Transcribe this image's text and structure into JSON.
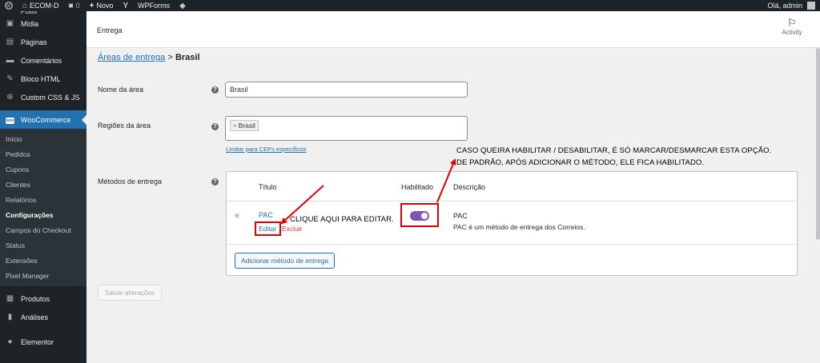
{
  "adminbar": {
    "site_name": "ECOM-D",
    "comments_count": "0",
    "new_label": "Novo",
    "wpforms_label": "WPForms",
    "greeting": "Olá, admin"
  },
  "sidebar": {
    "top_cut_label": "Posts",
    "items": [
      {
        "label": "Mídia",
        "icon": "media-icon"
      },
      {
        "label": "Páginas",
        "icon": "pages-icon"
      },
      {
        "label": "Comentários",
        "icon": "comments-icon"
      },
      {
        "label": "Bloco HTML",
        "icon": "pin-icon"
      },
      {
        "label": "Custom CSS & JS",
        "icon": "plus-circle-icon"
      }
    ],
    "woocommerce_label": "WooCommerce",
    "submenu": [
      "Início",
      "Pedidos",
      "Cupons",
      "Clientes",
      "Relatórios",
      "Configurações",
      "Campos do Checkout",
      "Status",
      "Extensões",
      "Pixel Manager"
    ],
    "active_submenu": "Configurações",
    "bottom_items": [
      {
        "label": "Produtos",
        "icon": "products-icon"
      },
      {
        "label": "Análises",
        "icon": "analytics-icon"
      },
      {
        "label": "Elementor",
        "icon": "elementor-icon"
      }
    ]
  },
  "header": {
    "title": "Entrega",
    "activity_label": "Activity"
  },
  "breadcrumb": {
    "link": "Áreas de entrega",
    "separator": ">",
    "current": "Brasil"
  },
  "form": {
    "zone_name_label": "Nome da área",
    "zone_name_value": "Brasil",
    "regions_label": "Regiões da área",
    "region_chip": "Brasil",
    "limit_postcodes_link": "Limitar para CEPs específicos",
    "methods_label": "Métodos de entrega"
  },
  "methods_table": {
    "col_title": "Título",
    "col_enabled": "Habilitado",
    "col_description": "Descrição",
    "rows": [
      {
        "title": "PAC",
        "edit": "Editar",
        "delete": "Excluir",
        "enabled": true,
        "desc_title": "PAC",
        "desc_text": "PAC é um método de entrega dos Correios."
      }
    ],
    "add_button": "Adicionar método de entrega"
  },
  "save_button": "Salvar alterações",
  "annotations": {
    "top_line1": "CASO QUEIRA HABILITAR / DESABILITAR, É SÓ MARCAR/DESMARCAR ESTA OPÇÃO.",
    "top_line2": "DE PADRÃO, APÓS ADICIONAR O MÉTODO, ELE FICA HABILITADO.",
    "edit_hint": "CLIQUE AQUI PARA EDITAR.",
    "color": "#e00000"
  },
  "colors": {
    "sidebar_bg": "#1d2327",
    "accent": "#2271b1",
    "toggle_on": "#7f54b3",
    "danger": "#d63638"
  }
}
